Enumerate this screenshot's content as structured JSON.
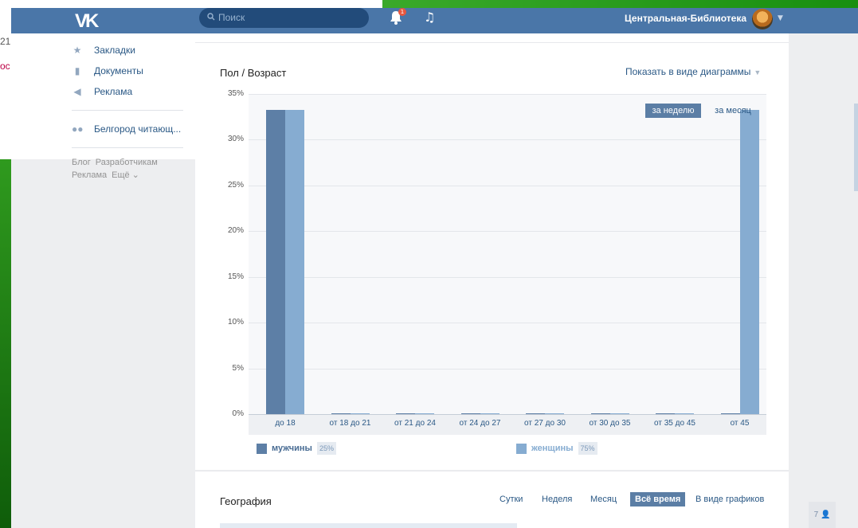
{
  "background": {
    "cut_text_1": "21",
    "cut_text_2": "ос"
  },
  "header": {
    "logo": "VK",
    "search_placeholder": "Поиск",
    "notifications_count": "1",
    "user_name": "Центральная-Библиотека"
  },
  "sidebar": {
    "items": [
      {
        "label": "Закладки",
        "icon": "star-icon"
      },
      {
        "label": "Документы",
        "icon": "document-icon"
      },
      {
        "label": "Реклама",
        "icon": "megaphone-icon"
      },
      {
        "label": "Белгород читающ...",
        "icon": "group-icon"
      }
    ],
    "footer_links": [
      "Блог",
      "Разработчикам",
      "Реклама",
      "Ещё ⌄"
    ]
  },
  "demographics": {
    "title": "Пол / Возраст",
    "view_toggle": "Показать в виде диаграммы",
    "period_week": "за неделю",
    "period_month": "за месяц",
    "legend": {
      "male_label": "мужчины",
      "male_percent": "25%",
      "female_label": "женщины",
      "female_percent": "75%"
    }
  },
  "chart_data": {
    "type": "bar",
    "categories": [
      "до 18",
      "от 18 до 21",
      "от 21 до 24",
      "от 24 до 27",
      "от 27 до 30",
      "от 30 до 35",
      "от 35 до 45",
      "от 45"
    ],
    "series": [
      {
        "name": "мужчины",
        "values": [
          33.3,
          0,
          0,
          0,
          0,
          0,
          0,
          0
        ]
      },
      {
        "name": "женщины",
        "values": [
          33.3,
          0,
          0,
          0,
          0,
          0,
          0,
          33.3
        ]
      }
    ],
    "yticks": [
      "0%",
      "5%",
      "10%",
      "15%",
      "20%",
      "25%",
      "30%",
      "35%"
    ],
    "ylim": [
      0,
      35
    ],
    "colors": {
      "male": "#5d7fa6",
      "female": "#86acd1"
    }
  },
  "geography": {
    "title": "География",
    "tabs": [
      "Сутки",
      "Неделя",
      "Месяц",
      "Всё время",
      "В виде графиков"
    ],
    "active_tab": "Всё время"
  },
  "online_count": "7"
}
